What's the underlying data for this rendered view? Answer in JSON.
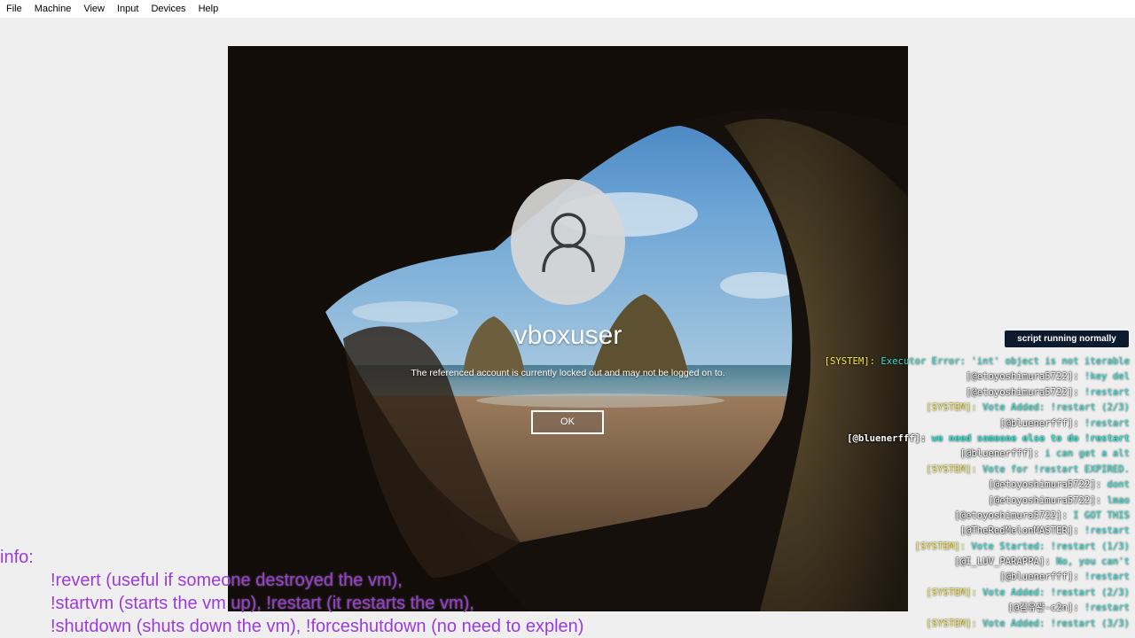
{
  "menubar": {
    "items": [
      {
        "label": "File"
      },
      {
        "label": "Machine"
      },
      {
        "label": "View"
      },
      {
        "label": "Input"
      },
      {
        "label": "Devices"
      },
      {
        "label": "Help"
      }
    ]
  },
  "vm": {
    "username": "vboxuser",
    "error_message": "The referenced account is currently locked out and may not be logged on to.",
    "ok_label": "OK",
    "avatar_icon": "user-icon"
  },
  "status": {
    "label": "script running normally"
  },
  "chat": [
    {
      "user": "[SYSTEM]:",
      "message": "Executor Error: 'int' object is not iterable",
      "type": "system"
    },
    {
      "user": "[@etoyoshimura5722]:",
      "message": "!key del",
      "type": "user"
    },
    {
      "user": "[@etoyoshimura5722]:",
      "message": "!restart",
      "type": "user"
    },
    {
      "user": "[SYSTEM]:",
      "message": "Vote Added: !restart (2/3)",
      "type": "system"
    },
    {
      "user": "[@bluenerfff]:",
      "message": "!restart",
      "type": "user"
    },
    {
      "user": "[@bluenerfff]:",
      "message": "we need someone else to do !restart",
      "type": "user-bold"
    },
    {
      "user": "[@bluenerfff]:",
      "message": "i can get a alt",
      "type": "user"
    },
    {
      "user": "[SYSTEM]:",
      "message": "Vote for !restart EXPIRED.",
      "type": "system"
    },
    {
      "user": "[@etoyoshimura5722]:",
      "message": "dont",
      "type": "user"
    },
    {
      "user": "[@etoyoshimura5722]:",
      "message": "lmao",
      "type": "user"
    },
    {
      "user": "[@etoyoshimura5722]:",
      "message": "I GOT THIS",
      "type": "user"
    },
    {
      "user": "[@TheRedMelonMASTER]:",
      "message": "!restart",
      "type": "user"
    },
    {
      "user": "[SYSTEM]:",
      "message": "Vote Started: !restart (1/3)",
      "type": "system"
    },
    {
      "user": "[@I_LUV_PARAPPA]:",
      "message": "No, you can't",
      "type": "user"
    },
    {
      "user": "[@bluenerfff]:",
      "message": "!restart",
      "type": "user"
    },
    {
      "user": "[SYSTEM]:",
      "message": "Vote Added: !restart (2/3)",
      "type": "system"
    },
    {
      "user": "[@김유관-c2n]:",
      "message": "!restart",
      "type": "user"
    },
    {
      "user": "[SYSTEM]:",
      "message": "Vote Added: !restart (3/3)",
      "type": "system"
    }
  ],
  "info": {
    "title": "info:",
    "lines": [
      "!revert (useful if someone destroyed the vm),",
      "!startvm (starts the vm up), !restart (it restarts the vm),",
      "!shutdown (shuts down the vm), !forceshutdown (no need to explen)"
    ]
  },
  "colors": {
    "info_text": "#9a3bd8",
    "chat_message": "#33e0d0",
    "chat_system": "#f5e84a",
    "status_bg": "#0d1a2e"
  }
}
